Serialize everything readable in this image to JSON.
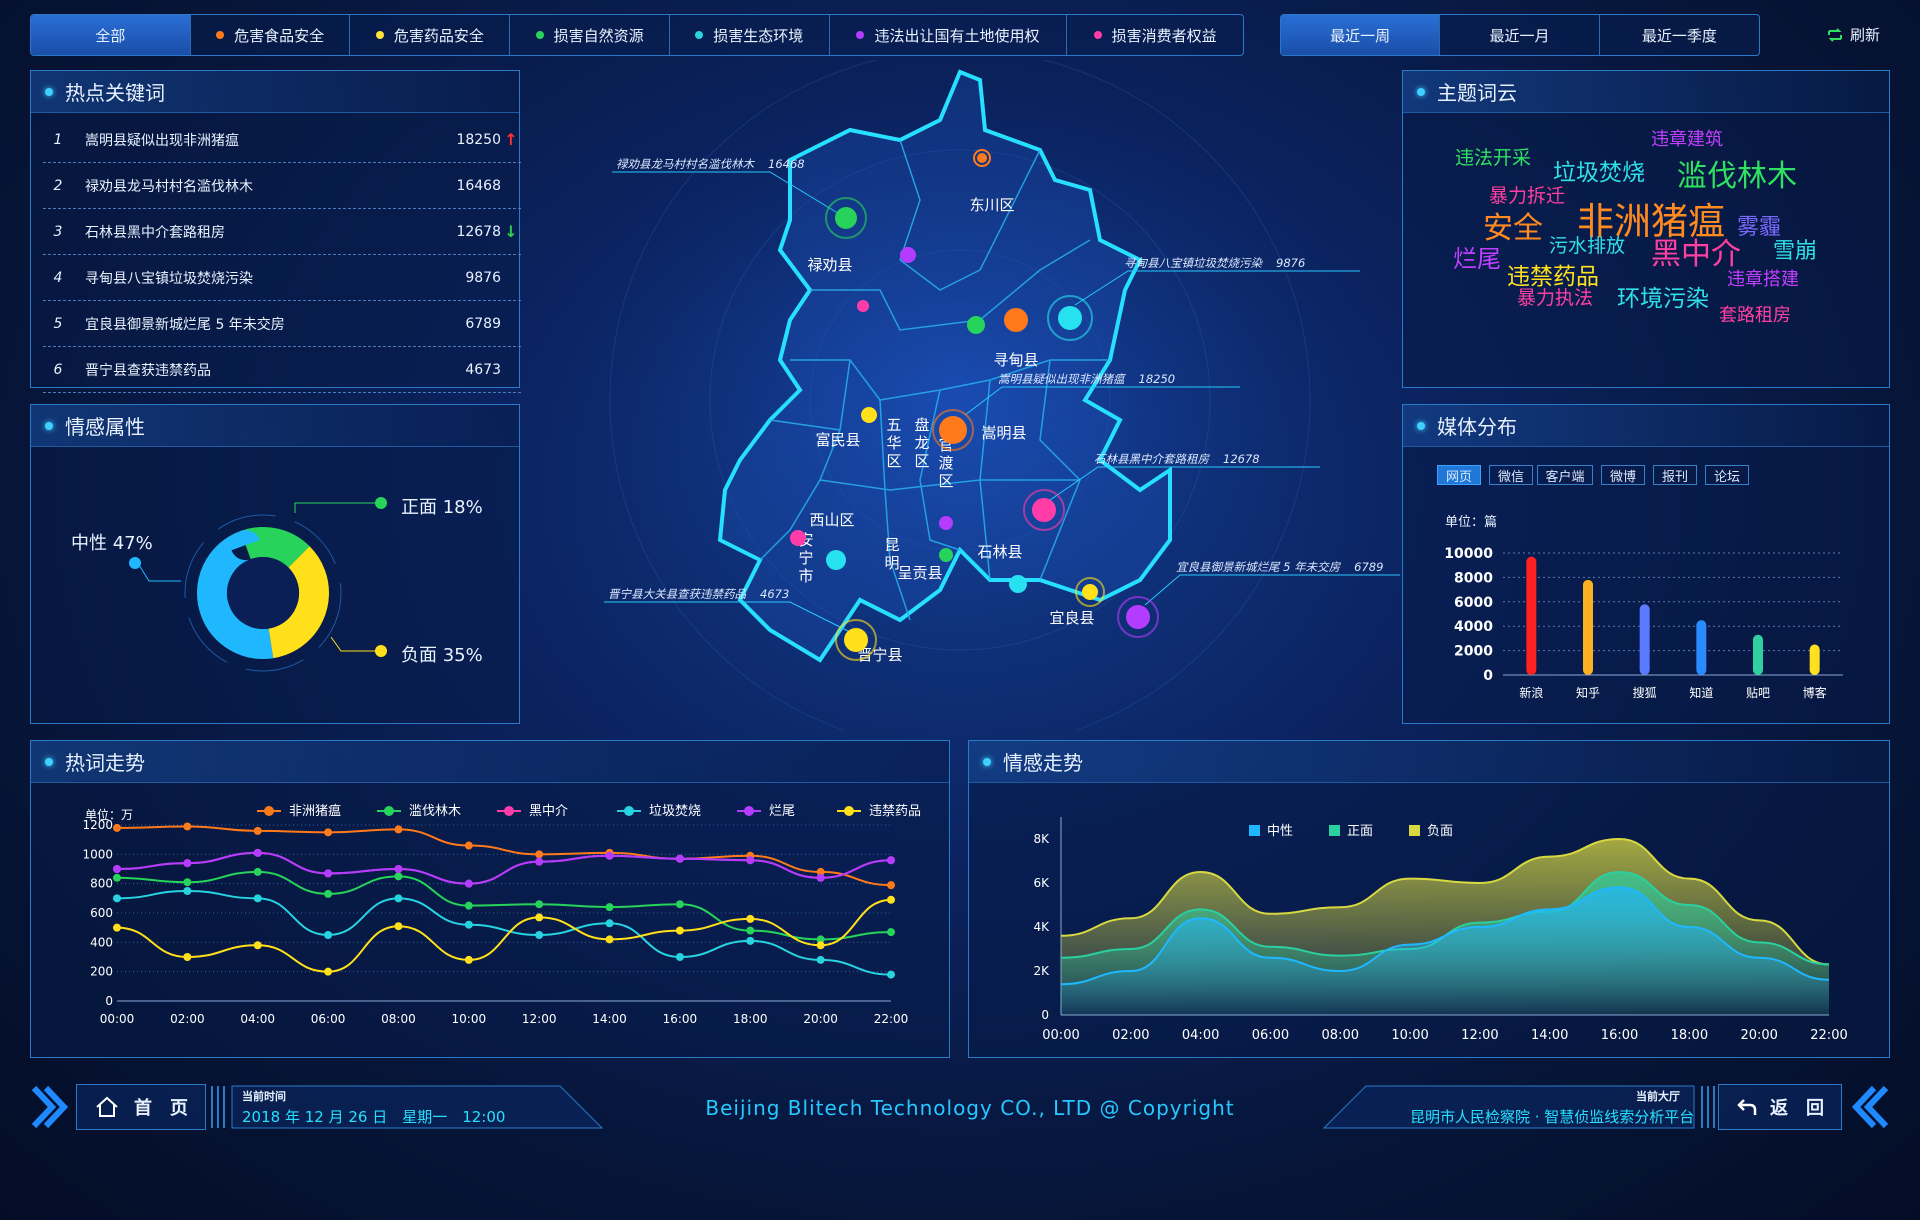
{
  "filters": {
    "categories": [
      {
        "label": "全部",
        "color": ""
      },
      {
        "label": "危害食品安全",
        "color": "#ff7a1a"
      },
      {
        "label": "危害药品安全",
        "color": "#ffe23a"
      },
      {
        "label": "损害自然资源",
        "color": "#27d35a"
      },
      {
        "label": "损害生态环境",
        "color": "#27d3e0"
      },
      {
        "label": "违法出让国有土地使用权",
        "color": "#b43cff"
      },
      {
        "label": "损害消费者权益",
        "color": "#ff3ca8"
      }
    ],
    "periods": [
      "最近一周",
      "最近一月",
      "最近一季度"
    ],
    "refresh": "刷新"
  },
  "hot_keywords": {
    "title": "热点关键词",
    "rows": [
      {
        "rank": "1",
        "text": "嵩明县疑似出现非洲猪瘟",
        "value": "18250",
        "trend": "up"
      },
      {
        "rank": "2",
        "text": "禄劝县龙马村村名滥伐林木",
        "value": "16468",
        "trend": ""
      },
      {
        "rank": "3",
        "text": "石林县黑中介套路租房",
        "value": "12678",
        "trend": "down"
      },
      {
        "rank": "4",
        "text": "寻甸县八宝镇垃圾焚烧污染",
        "value": "9876",
        "trend": ""
      },
      {
        "rank": "5",
        "text": "宜良县御景新城烂尾 5 年未交房",
        "value": "6789",
        "trend": ""
      },
      {
        "rank": "6",
        "text": "晋宁县查获违禁药品",
        "value": "4673",
        "trend": ""
      }
    ]
  },
  "sentiment": {
    "title": "情感属性",
    "neutral": "中性 47%",
    "positive": "正面 18%",
    "negative": "负面 35%",
    "slices": [
      {
        "name": "中性",
        "value": 47,
        "color": "#1fb8ff"
      },
      {
        "name": "正面",
        "value": 18,
        "color": "#27d35a"
      },
      {
        "name": "负面",
        "value": 35,
        "color": "#ffe01a"
      }
    ]
  },
  "map": {
    "districts": [
      "东川区",
      "禄劝县",
      "寻甸县",
      "富民县",
      "嵩明县",
      "五华区",
      "盘龙区",
      "官渡区",
      "西山区",
      "安宁市",
      "昆明",
      "呈贡县",
      "石林县",
      "宜良县",
      "晋宁县"
    ],
    "callouts": [
      {
        "text": "禄劝县龙马村村名滥伐林木",
        "value": "16468"
      },
      {
        "text": "寻甸县八宝镇垃圾焚烧污染",
        "value": "9876"
      },
      {
        "text": "嵩明县疑似出现非洲猪瘟",
        "value": "18250"
      },
      {
        "text": "石林县黑中介套路租房",
        "value": "12678"
      },
      {
        "text": "宜良县御景新城烂尾 5 年未交房",
        "value": "6789"
      },
      {
        "text": "晋宁县大关县查获违禁药品",
        "value": "4673"
      }
    ]
  },
  "wordcloud": {
    "title": "主题词云",
    "words": [
      {
        "text": "违章建筑",
        "color": "#c040ff"
      },
      {
        "text": "违法开采",
        "color": "#30e060"
      },
      {
        "text": "垃圾焚烧",
        "color": "#30e0e8"
      },
      {
        "text": "滥伐林木",
        "color": "#30e060"
      },
      {
        "text": "暴力拆迁",
        "color": "#ff40a0"
      },
      {
        "text": "安全",
        "color": "#ff8a20"
      },
      {
        "text": "非洲猪瘟",
        "color": "#ff8a20"
      },
      {
        "text": "雾霾",
        "color": "#7a6aff"
      },
      {
        "text": "烂尾",
        "color": "#c040ff"
      },
      {
        "text": "污水排放",
        "color": "#30e0e8"
      },
      {
        "text": "黑中介",
        "color": "#ff40a0"
      },
      {
        "text": "雪崩",
        "color": "#30e0e8"
      },
      {
        "text": "违禁药品",
        "color": "#ffe020"
      },
      {
        "text": "违章搭建",
        "color": "#c040ff"
      },
      {
        "text": "暴力执法",
        "color": "#ff40a0"
      },
      {
        "text": "环境污染",
        "color": "#30e0e8"
      },
      {
        "text": "套路租房",
        "color": "#ff40a0"
      }
    ]
  },
  "media": {
    "title": "媒体分布",
    "tabs": [
      "网页",
      "微信",
      "客户端",
      "微博",
      "报刊",
      "论坛"
    ],
    "unit": "单位：篇"
  },
  "trend": {
    "title": "热词走势",
    "unit": "单位：万"
  },
  "emotion_trend": {
    "title": "情感走势"
  },
  "footer": {
    "home": "首　页",
    "time_label": "当前时间",
    "time_value": "2018 年 12 月 26 日　星期一　12:00",
    "copyright": "Beijing Blitech Technology CO., LTD @ Copyright",
    "hall_label": "当前大厅",
    "hall_value": "昆明市人民检察院 · 智慧侦监线索分析平台",
    "back": "返　回"
  },
  "chart_data": [
    {
      "type": "bar",
      "categories": [
        "新浪",
        "知乎",
        "搜狐",
        "知道",
        "贴吧",
        "博客"
      ],
      "values": [
        9700,
        7800,
        5800,
        4500,
        3300,
        2500
      ],
      "colors": [
        "#ff2020",
        "#ffb020",
        "#5a7aff",
        "#2a8aff",
        "#30d0a0",
        "#ffe020"
      ],
      "ylabel": "单位：篇",
      "ylim": [
        0,
        10000
      ],
      "yticks": [
        0,
        2000,
        4000,
        6000,
        8000,
        10000
      ]
    },
    {
      "type": "line",
      "x": [
        "00:00",
        "02:00",
        "04:00",
        "06:00",
        "08:00",
        "10:00",
        "12:00",
        "14:00",
        "16:00",
        "18:00",
        "20:00",
        "22:00"
      ],
      "ylim": [
        0,
        1200
      ],
      "yticks": [
        0,
        200,
        400,
        600,
        800,
        1000,
        1200
      ],
      "ylabel": "单位：万",
      "series": [
        {
          "name": "非洲猪瘟",
          "color": "#ff7a1a",
          "values": [
            1180,
            1190,
            1160,
            1150,
            1170,
            1060,
            1000,
            1010,
            970,
            990,
            880,
            790
          ]
        },
        {
          "name": "滥伐林木",
          "color": "#27d35a",
          "values": [
            840,
            810,
            880,
            730,
            850,
            650,
            660,
            640,
            660,
            480,
            420,
            470
          ]
        },
        {
          "name": "黑中介",
          "color": "#ff3ca8",
          "values": [
            900,
            940,
            1010,
            870,
            900,
            800,
            950,
            990,
            970,
            960,
            840,
            960
          ]
        },
        {
          "name": "垃圾焚烧",
          "color": "#27d3e0",
          "values": [
            700,
            750,
            700,
            450,
            700,
            520,
            450,
            530,
            300,
            410,
            280,
            180
          ]
        },
        {
          "name": "烂尾",
          "color": "#b43cff",
          "values": [
            900,
            940,
            1010,
            870,
            900,
            800,
            950,
            990,
            970,
            960,
            840,
            960
          ]
        },
        {
          "name": "违禁药品",
          "color": "#ffe01a",
          "values": [
            500,
            300,
            380,
            200,
            510,
            280,
            570,
            420,
            480,
            560,
            380,
            690
          ]
        }
      ]
    },
    {
      "type": "area",
      "x": [
        "00:00",
        "02:00",
        "04:00",
        "06:00",
        "08:00",
        "10:00",
        "12:00",
        "14:00",
        "16:00",
        "18:00",
        "20:00",
        "22:00"
      ],
      "ylim": [
        0,
        9000
      ],
      "yticks": [
        "0",
        "2K",
        "4K",
        "6K",
        "8K"
      ],
      "series": [
        {
          "name": "中性",
          "color": "#1fb8ff",
          "values": [
            1400,
            2000,
            4400,
            2600,
            2000,
            3200,
            4000,
            4800,
            5800,
            4000,
            2600,
            1600
          ]
        },
        {
          "name": "正面",
          "color": "#2ad0a0",
          "values": [
            2600,
            3000,
            4800,
            3100,
            2700,
            3000,
            4200,
            4700,
            6500,
            5000,
            3300,
            2300
          ]
        },
        {
          "name": "负面",
          "color": "#d8d840",
          "values": [
            3600,
            4400,
            6500,
            4600,
            4900,
            6200,
            6000,
            7200,
            8000,
            6200,
            4300,
            2300
          ]
        }
      ]
    }
  ]
}
